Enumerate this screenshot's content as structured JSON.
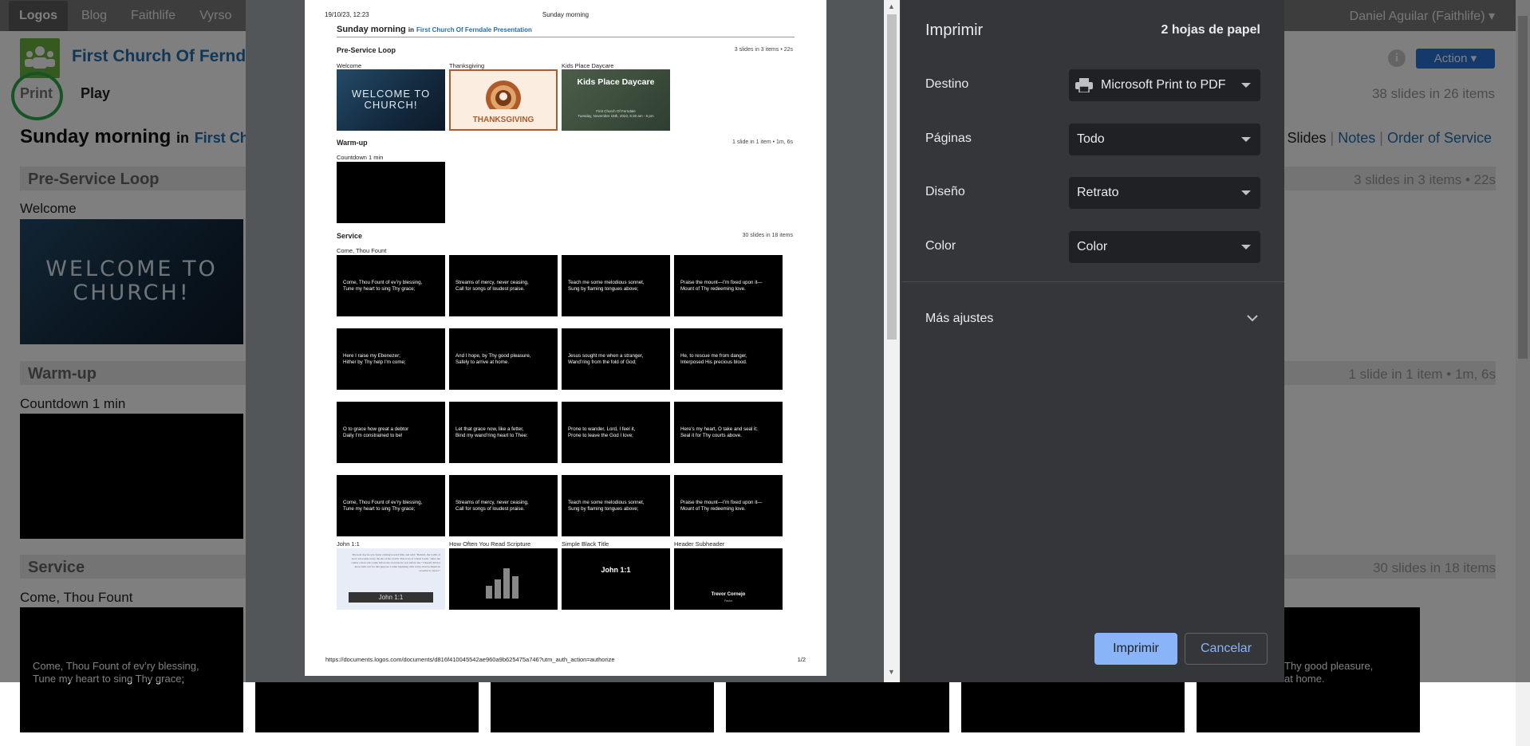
{
  "topnav": {
    "tabs": [
      "Logos",
      "Blog",
      "Faithlife",
      "Vyrso"
    ],
    "active_tab": "Logos",
    "user": "Daniel Aguilar (Faithlife) ▾"
  },
  "page": {
    "church_name": "First Church Of Ferndale Presentation",
    "print_label": "Print",
    "play_label": "Play",
    "doc_title": "Sunday morning",
    "doc_title_in": "in",
    "doc_title_church": "First Church Of Ferndale Presentation",
    "info_icon": "info-icon",
    "action_label": "Action ▾",
    "slide_count": "38 slides in 26 items",
    "view_tabs": [
      "Slides",
      "Notes",
      "Order of Service"
    ],
    "sections": [
      {
        "name": "Pre-Service Loop",
        "info": "3 slides in 3 items • 22s"
      },
      {
        "name": "Warm-up",
        "info": "1 slide in 1 item • 1m, 6s"
      },
      {
        "name": "Service",
        "info": "30 slides in 18 items"
      }
    ],
    "items": {
      "welcome": "Welcome",
      "welcome_slide": "WELCOME TO CHURCH!",
      "countdown": "Countdown 1 min",
      "come_thou": "Come, Thou Fount",
      "come_thou_lines": [
        "Come, Thou Fount of ev’ry blessing,",
        "Tune my heart to sing Thy grace;"
      ],
      "partial_right": [
        "Thy good pleasure,",
        "at home."
      ]
    },
    "colors": {
      "accent": "#1f6fb0",
      "action": "#2875d6",
      "logo": "#6cb33f",
      "print_ring": "#2ea84a"
    }
  },
  "preview": {
    "date": "19/10/23, 12:23",
    "header": "Sunday morning",
    "title": "Sunday morning",
    "title_in": "in",
    "title_church": "First Church Of Ferndale Presentation",
    "sections": [
      {
        "name": "Pre-Service Loop",
        "info": "3 slides in 3 items • 22s"
      },
      {
        "name": "Warm-up",
        "info": "1 slide in 1 item • 1m, 6s"
      },
      {
        "name": "Service",
        "info": "30 slides in 18 items"
      }
    ],
    "preservice_labels": [
      "Welcome",
      "Thanksgiving",
      "Kids Place Daycare"
    ],
    "welcome_text": "WELCOME TO CHURCH!",
    "thanks_text": "THANKSGIVING",
    "kids_title": "Kids Place Daycare",
    "kids_sub": "First Church Of Ferndale\nTuesday, November 16th, 2023, 6:30 am - 6 pm",
    "warmup_label": "Countdown 1 min",
    "service_label": "Come, Thou Fount",
    "lyrics": [
      [
        "Come, Thou Fount of ev’ry blessing,",
        "Tune my heart to sing Thy grace;"
      ],
      [
        "Streams of mercy, never ceasing,",
        "Call for songs of loudest praise."
      ],
      [
        "Teach me some melodious sonnet,",
        "Sung by flaming tongues above;"
      ],
      [
        "Praise the mount—I’m fixed upon it—",
        "Mount of Thy redeeming love."
      ],
      [
        "Here I raise my Ebenezer;",
        "Hither by Thy help I’m come;"
      ],
      [
        "And I hope, by Thy good pleasure,",
        "Safely to arrive at home."
      ],
      [
        "Jesus sought me when a stranger,",
        "Wand’ring from the fold of God;"
      ],
      [
        "He, to rescue me from danger,",
        "Interposed His precious blood."
      ],
      [
        "O to grace how great a debtor",
        "Daily I’m constrained to be!"
      ],
      [
        "Let that grace now, like a fetter,",
        "Bind my wand’ring heart to Thee:"
      ],
      [
        "Prone to wander, Lord, I feel it,",
        "Prone to leave the God I love;"
      ],
      [
        "Here’s my heart, O take and seal it;",
        "Seal it for Thy courts above."
      ],
      [
        "Come, Thou Fount of ev’ry blessing,",
        "Tune my heart to sing Thy grace;"
      ],
      [
        "Streams of mercy, never ceasing,",
        "Call for songs of loudest praise."
      ],
      [
        "Teach me some melodious sonnet,",
        "Sung by flaming tongues above;"
      ],
      [
        "Praise the mount—I’m fixed upon it—",
        "Mount of Thy redeeming love."
      ]
    ],
    "last_row_labels": [
      "John 1:1",
      "How Often You Read Scripture",
      "Simple Black Title",
      "Header Subheader"
    ],
    "john_text": "The next day he saw Jesus coming toward him, and said, “Behold, the Lamb of God, who takes away the sin of the world! This is he of whom I said, ‘After me comes a man who ranks before me, because he was before me.’ I myself did not know him, but for this purpose I came baptizing with water, that he might be revealed to Israel.”",
    "john_bar": "John 1:1",
    "simple_title": "John 1:1",
    "hs_title": "Trevor Cornejo",
    "hs_sub": "Pastor",
    "footer_url": "https://documents.logos.com/documents/d816f410045542ae960a9b625475a746?utm_auth_action=authorize",
    "page_num": "1/2"
  },
  "settings": {
    "title": "Imprimir",
    "sheets": "2 hojas de papel",
    "rows": [
      {
        "label": "Destino",
        "value": "Microsoft Print to PDF"
      },
      {
        "label": "Páginas",
        "value": "Todo"
      },
      {
        "label": "Diseño",
        "value": "Retrato"
      },
      {
        "label": "Color",
        "value": "Color"
      }
    ],
    "more": "Más ajustes",
    "print_btn": "Imprimir",
    "cancel_btn": "Cancelar",
    "colors": {
      "panel": "#35363a",
      "primary": "#8ab4f8"
    }
  }
}
